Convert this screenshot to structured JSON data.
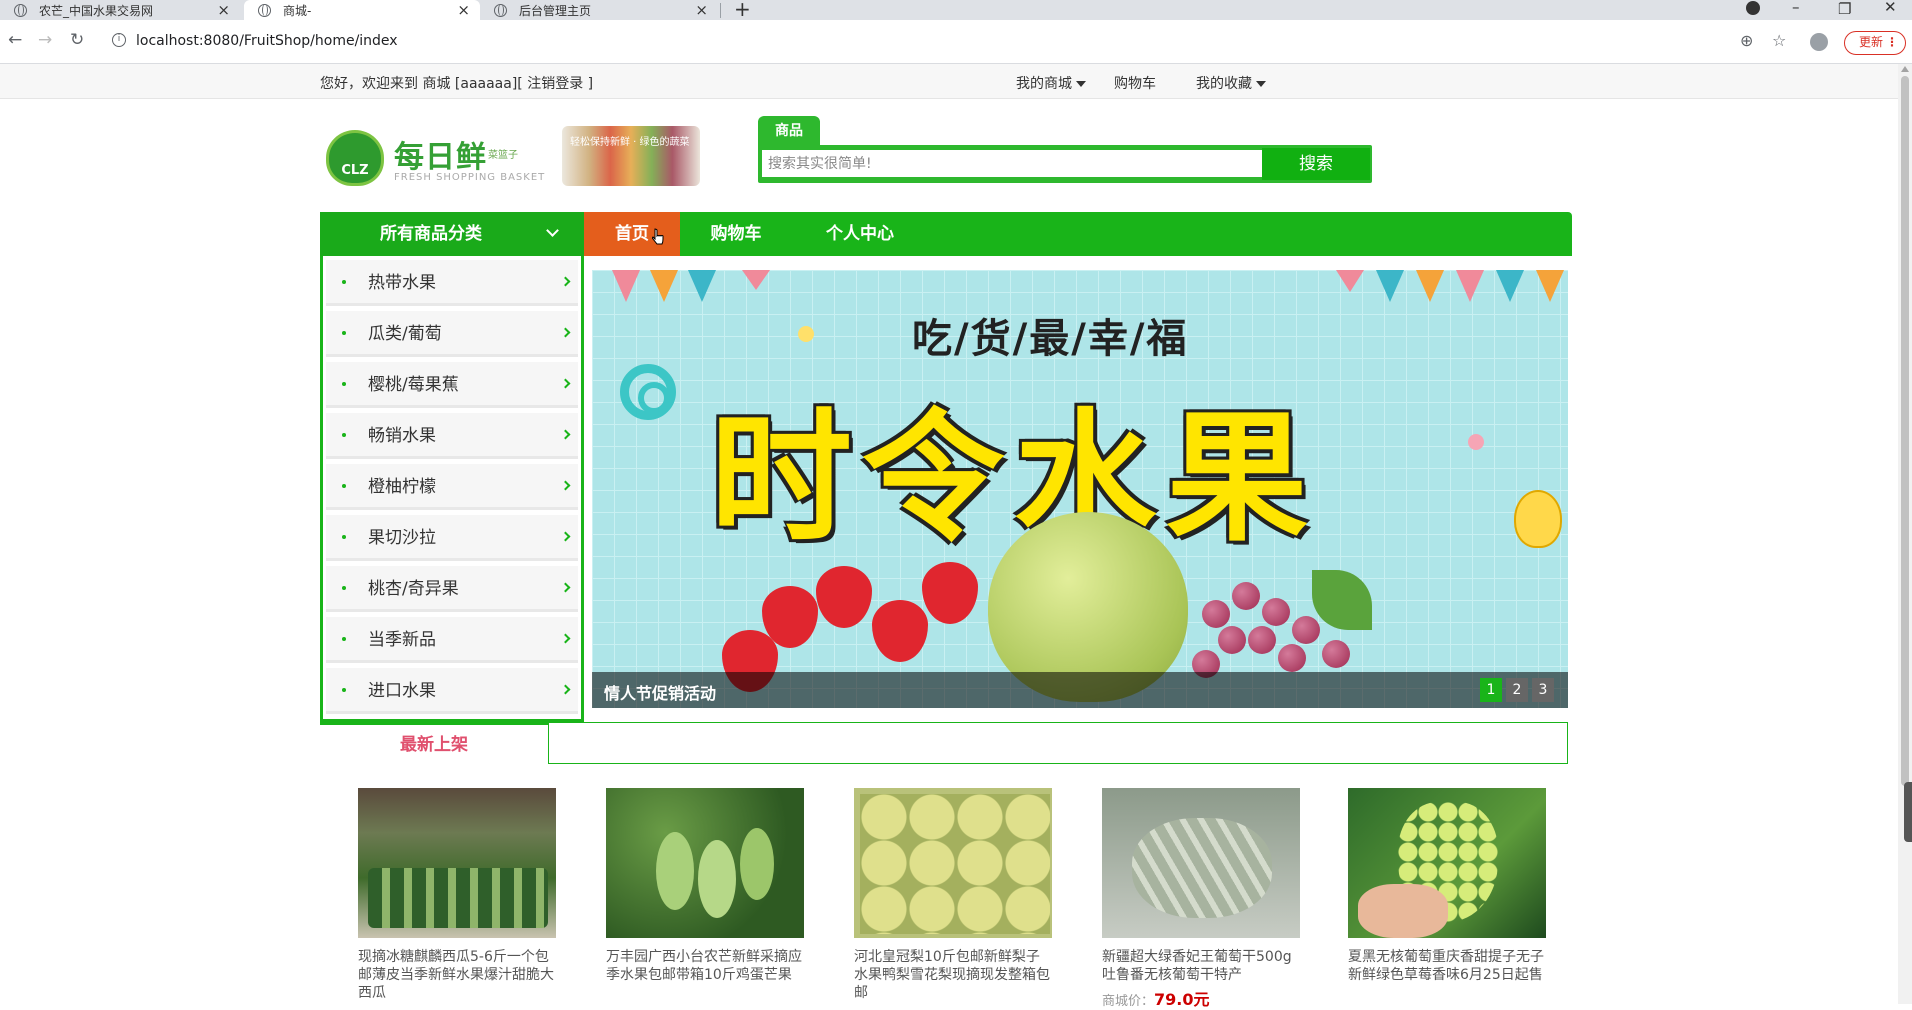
{
  "browser": {
    "tabs": [
      {
        "title": "农芒_中国水果交易网"
      },
      {
        "title": "商城-"
      },
      {
        "title": "后台管理主页"
      }
    ],
    "url": "localhost:8080/FruitShop/home/index",
    "update_label": "更新"
  },
  "topbar": {
    "welcome": "您好，欢迎来到 商城 [aaaaaa][ 注销登录 ]",
    "links": [
      "我的商城",
      "购物车",
      "我的收藏"
    ]
  },
  "logo": {
    "badge": "CLZ",
    "name": "每日鲜",
    "sub": "菜篮子",
    "slogan": "轻松保持新鲜 · 绿色的蔬菜",
    "en": "FRESH SHOPPING BASKET"
  },
  "search": {
    "tab_label": "商品",
    "placeholder": "搜索其实很简单!",
    "button_label": "搜索"
  },
  "nav": {
    "all_categories": "所有商品分类",
    "items": [
      "首页",
      "购物车",
      "个人中心"
    ]
  },
  "categories": [
    "热带水果",
    "瓜类/葡萄",
    "樱桃/莓果蕉",
    "畅销水果",
    "橙柚柠檬",
    "果切沙拉",
    "桃杏/奇异果",
    "当季新品",
    "进口水果"
  ],
  "banner": {
    "slogan": "吃/货/最/幸/福",
    "title": "时令水果",
    "caption": "情人节促销活动",
    "pages": [
      "1",
      "2",
      "3"
    ]
  },
  "section": {
    "title": "最新上架"
  },
  "products": [
    {
      "title": "现摘冰糖麒麟西瓜5-6斤一个包邮薄皮当季新鲜水果爆汁甜脆大西瓜",
      "price_label": "",
      "price": ""
    },
    {
      "title": "万丰园广西小台农芒新鲜采摘应季水果包邮带箱10斤鸡蛋芒果",
      "price_label": "",
      "price": ""
    },
    {
      "title": "河北皇冠梨10斤包邮新鲜梨子水果鸭梨雪花梨现摘现发整箱包邮",
      "price_label": "",
      "price": ""
    },
    {
      "title": "新疆超大绿香妃王葡萄干500g吐鲁番无核葡萄干特产",
      "price_label": "商城价：",
      "price": "79.0元"
    },
    {
      "title": "夏黑无核葡萄重庆香甜提子无子新鲜绿色草莓香味6月25日起售",
      "price_label": "",
      "price": ""
    }
  ]
}
